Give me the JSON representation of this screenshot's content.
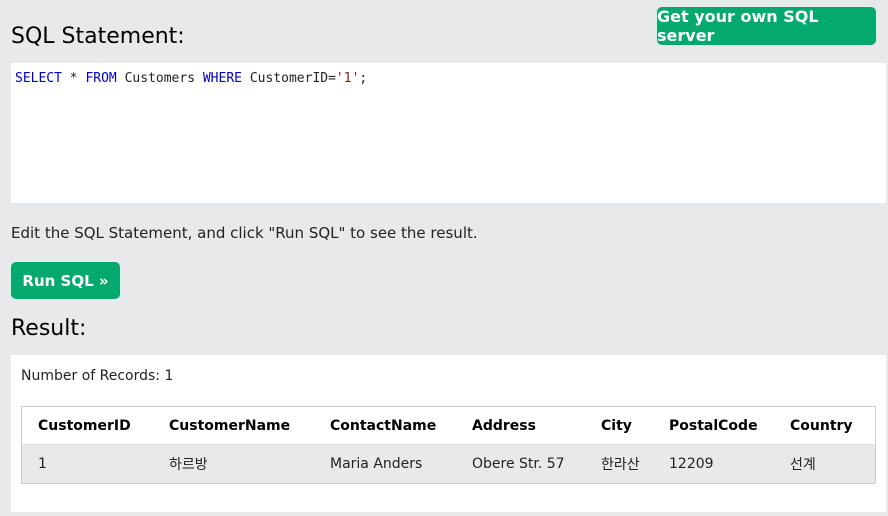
{
  "header": {
    "sql_title": "SQL Statement:",
    "get_server_label": "Get your own SQL server"
  },
  "editor": {
    "tokens": [
      {
        "text": "SELECT",
        "type": "keyword"
      },
      {
        "text": " * ",
        "type": "plain"
      },
      {
        "text": "FROM",
        "type": "keyword"
      },
      {
        "text": " Customers ",
        "type": "plain"
      },
      {
        "text": "WHERE",
        "type": "keyword"
      },
      {
        "text": " CustomerID=",
        "type": "plain"
      },
      {
        "text": "'1'",
        "type": "string"
      },
      {
        "text": ";",
        "type": "plain"
      }
    ]
  },
  "hint": "Edit the SQL Statement, and click \"Run SQL\" to see the result.",
  "run_label": "Run SQL »",
  "result": {
    "title": "Result:",
    "record_count": "Number of Records: 1",
    "columns": [
      "CustomerID",
      "CustomerName",
      "ContactName",
      "Address",
      "City",
      "PostalCode",
      "Country"
    ],
    "rows": [
      [
        "1",
        "하르방",
        "Maria Anders",
        "Obere Str. 57",
        "한라산",
        "12209",
        "선계"
      ]
    ]
  },
  "colors": {
    "accent": "#04aa6d",
    "background": "#e7e9eb",
    "keyword": "#0000cc",
    "string": "#a11"
  }
}
